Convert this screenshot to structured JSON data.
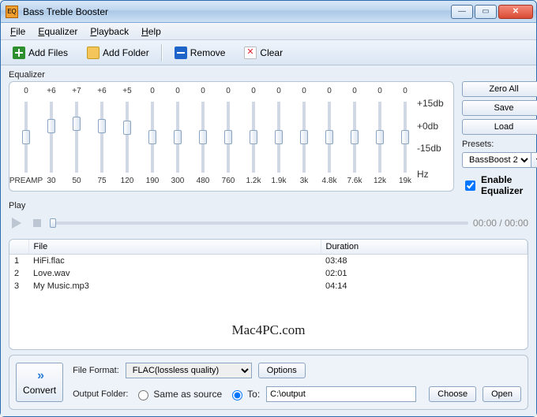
{
  "window": {
    "title": "Bass Treble Booster"
  },
  "menu": {
    "file": "File",
    "equalizer": "Equalizer",
    "playback": "Playback",
    "help": "Help"
  },
  "toolbar": {
    "add_files": "Add Files",
    "add_folder": "Add Folder",
    "remove": "Remove",
    "clear": "Clear"
  },
  "eq": {
    "label": "Equalizer",
    "bands": [
      {
        "freq": "PREAMP",
        "gain": "0",
        "pos": 0
      },
      {
        "freq": "30",
        "gain": "+6",
        "pos": 6
      },
      {
        "freq": "50",
        "gain": "+7",
        "pos": 7
      },
      {
        "freq": "75",
        "gain": "+6",
        "pos": 6
      },
      {
        "freq": "120",
        "gain": "+5",
        "pos": 5
      },
      {
        "freq": "190",
        "gain": "0",
        "pos": 0
      },
      {
        "freq": "300",
        "gain": "0",
        "pos": 0
      },
      {
        "freq": "480",
        "gain": "0",
        "pos": 0
      },
      {
        "freq": "760",
        "gain": "0",
        "pos": 0
      },
      {
        "freq": "1.2k",
        "gain": "0",
        "pos": 0
      },
      {
        "freq": "1.9k",
        "gain": "0",
        "pos": 0
      },
      {
        "freq": "3k",
        "gain": "0",
        "pos": 0
      },
      {
        "freq": "4.8k",
        "gain": "0",
        "pos": 0
      },
      {
        "freq": "7.6k",
        "gain": "0",
        "pos": 0
      },
      {
        "freq": "12k",
        "gain": "0",
        "pos": 0
      },
      {
        "freq": "19k",
        "gain": "0",
        "pos": 0
      }
    ],
    "scale": {
      "top": "+15db",
      "mid": "+0db",
      "bot": "-15db",
      "unit": "Hz"
    },
    "side": {
      "zero_all": "Zero All",
      "save": "Save",
      "load": "Load",
      "presets_label": "Presets:",
      "preset_selected": "BassBoost 2",
      "enable_label": "Enable Equalizer",
      "enable_checked": true
    }
  },
  "play": {
    "label": "Play",
    "elapsed": "00:00",
    "total": "00:00",
    "sep": " / "
  },
  "list": {
    "cols": {
      "idx": "",
      "file": "File",
      "dur": "Duration"
    },
    "rows": [
      {
        "n": "1",
        "name": "HiFi.flac",
        "dur": "03:48"
      },
      {
        "n": "2",
        "name": "Love.wav",
        "dur": "02:01"
      },
      {
        "n": "3",
        "name": "My Music.mp3",
        "dur": "04:14"
      }
    ],
    "watermark": "Mac4PC.com"
  },
  "bottom": {
    "convert": "Convert",
    "file_format_label": "File Format:",
    "file_format": "FLAC(lossless quality)",
    "options": "Options",
    "output_folder_label": "Output Folder:",
    "same_as_source": "Same as source",
    "to_label": "To:",
    "to_value": "C:\\output",
    "choose": "Choose",
    "open": "Open"
  }
}
